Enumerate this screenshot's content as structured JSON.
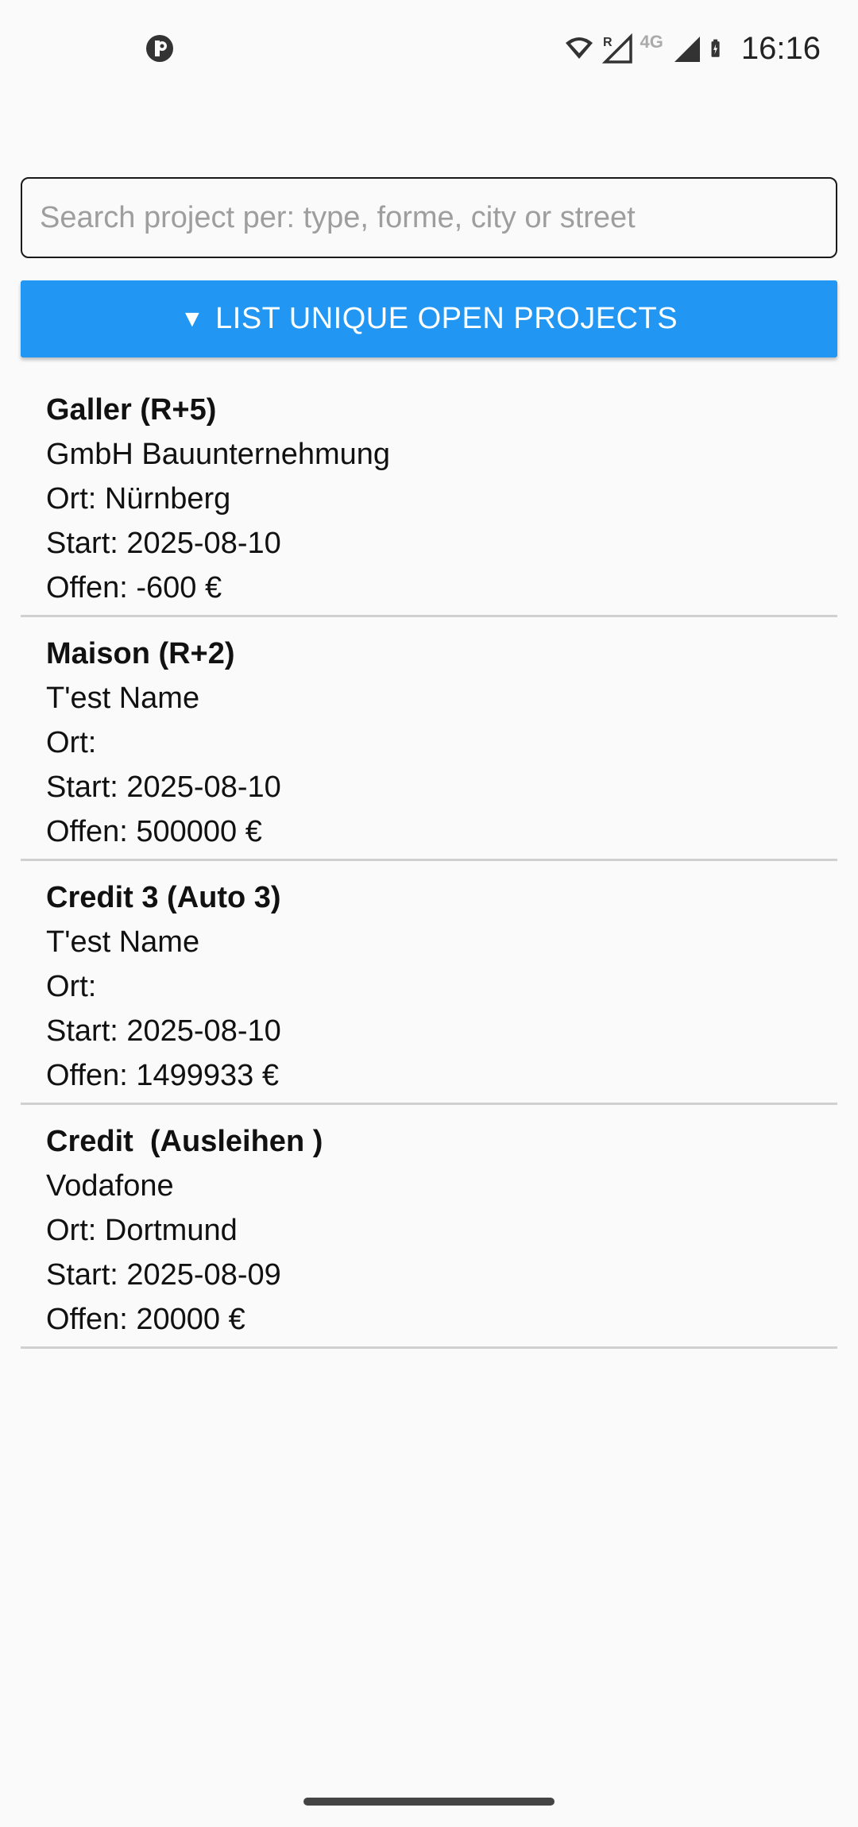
{
  "status_bar": {
    "time": "16:16",
    "icons": [
      "app-notification-icon",
      "wifi-icon",
      "signal-roaming-icon",
      "network-4g-icon",
      "signal-icon",
      "battery-charging-icon"
    ],
    "network_label": "4G",
    "roaming_label": "R"
  },
  "search": {
    "placeholder": "Search project per: type, forme, city or street",
    "value": ""
  },
  "list_button": {
    "arrow": "▼",
    "label": "LIST UNIQUE OPEN PROJECTS",
    "color": "#2196f3"
  },
  "projects": [
    {
      "title": "Galler (R+5)",
      "name": "GmbH Bauunternehmung",
      "ort": "Ort: Nürnberg",
      "start": "Start: 2025-08-10",
      "offen": "Offen: -600 €"
    },
    {
      "title": "Maison (R+2)",
      "name": "T'est Name",
      "ort": "Ort: ",
      "start": "Start: 2025-08-10",
      "offen": "Offen: 500000 €"
    },
    {
      "title": "Credit 3 (Auto 3)",
      "name": "T'est Name",
      "ort": "Ort: ",
      "start": "Start: 2025-08-10",
      "offen": "Offen: 1499933 €"
    },
    {
      "title": "Credit  (Ausleihen )",
      "name": "Vodafone",
      "ort": "Ort: Dortmund",
      "start": "Start: 2025-08-09",
      "offen": "Offen: 20000 €"
    }
  ]
}
